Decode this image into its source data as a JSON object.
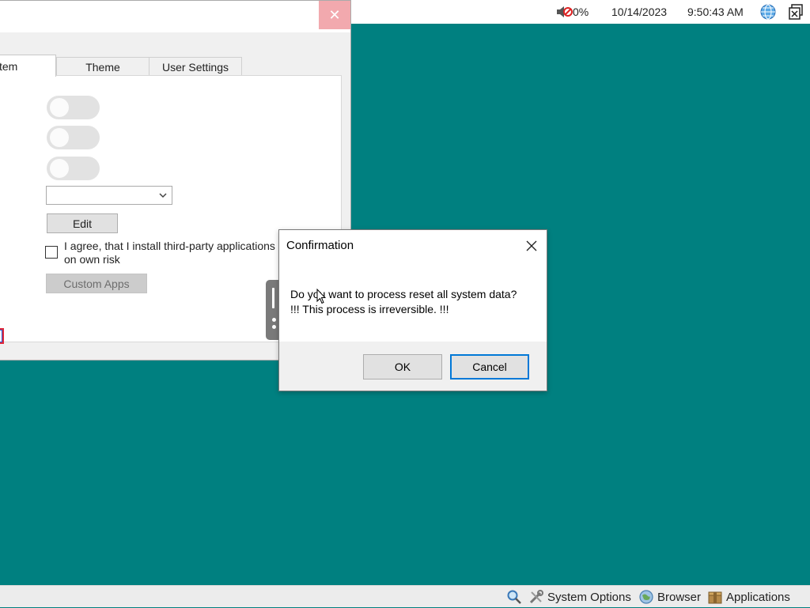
{
  "tray": {
    "volume_text": "0%",
    "date": "10/14/2023",
    "time": "9:50:43 AM",
    "volume_icon": "speaker-muted-icon",
    "globe_icon": "globe-icon",
    "apps_icon": "window-close-icon"
  },
  "settings_window": {
    "close_glyph": "✕",
    "tabs": [
      {
        "label": "stem",
        "active": true
      },
      {
        "label": "Theme",
        "active": false
      },
      {
        "label": "User Settings",
        "active": false
      }
    ],
    "combo_value": "",
    "edit_label": "Edit",
    "agree_label": "I agree, that I install third-party applications on own risk",
    "agree_checked": false,
    "custom_apps_label": "Custom Apps"
  },
  "dialog": {
    "title": "Confirmation",
    "close_glyph": "✕",
    "message_line1": "Do you want to process reset all system data?",
    "message_line2": "!!! This process is irreversible. !!!",
    "ok_label": "OK",
    "cancel_label": "Cancel"
  },
  "taskbar": {
    "system_options_label": "System Options",
    "browser_label": "Browser",
    "applications_label": "Applications"
  },
  "colors": {
    "desktop": "#008080",
    "accent": "#0078d7"
  }
}
